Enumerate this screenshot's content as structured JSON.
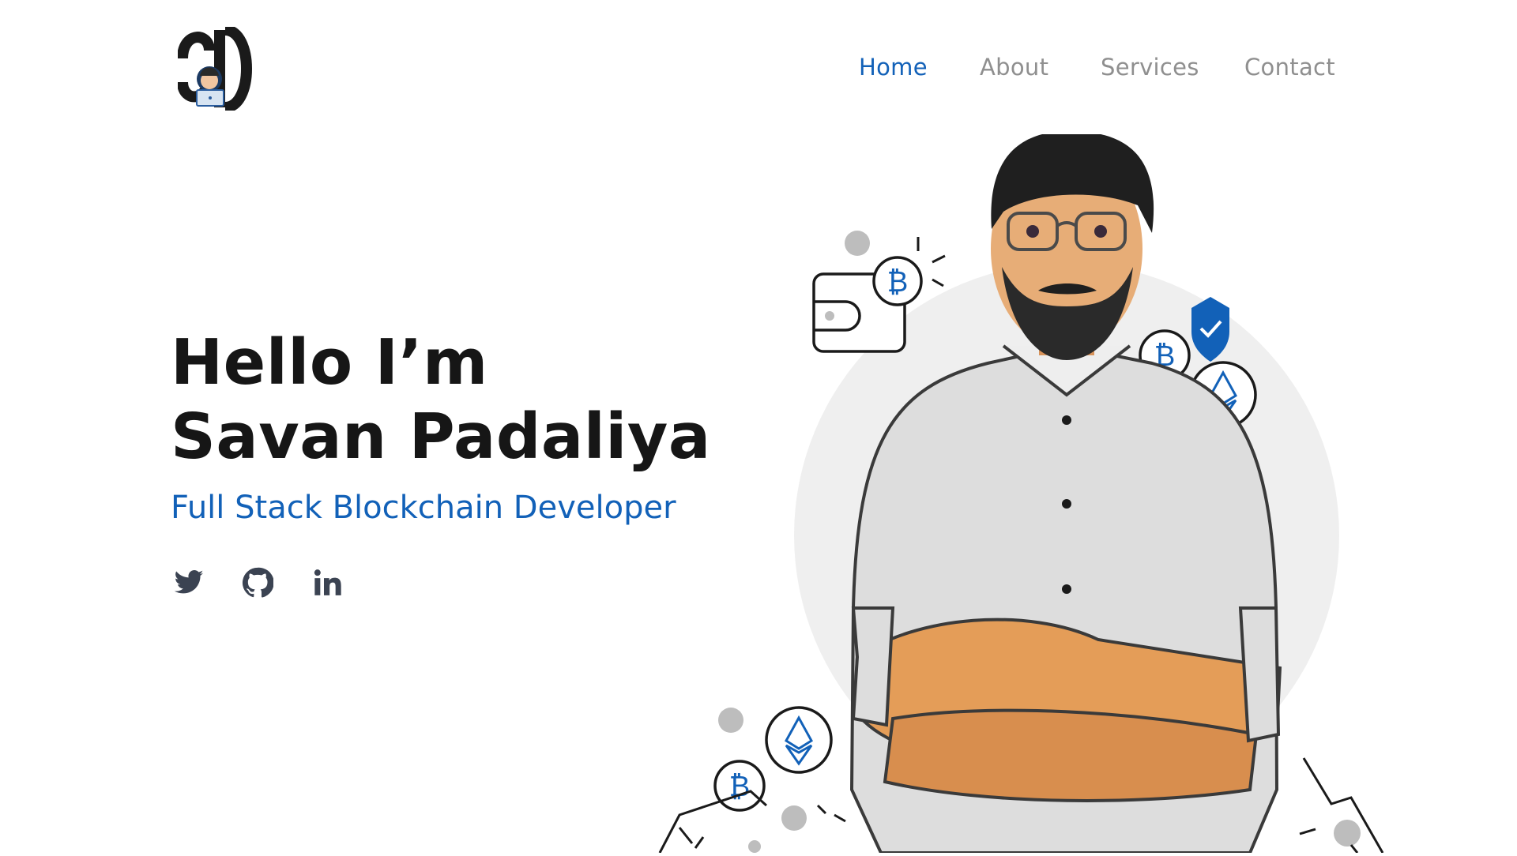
{
  "brand": {
    "logo_icon": "sd-developer-logo"
  },
  "nav": [
    {
      "label": "Home",
      "active": true
    },
    {
      "label": "About",
      "active": false
    },
    {
      "label": "Services",
      "active": false
    },
    {
      "label": "Contact",
      "active": false
    }
  ],
  "hero": {
    "line1": "Hello I’m",
    "line2": "Savan Padaliya",
    "subtitle": "Full Stack Blockchain Developer"
  },
  "socials": [
    {
      "icon": "twitter-icon"
    },
    {
      "icon": "github-icon"
    },
    {
      "icon": "linkedin-icon"
    }
  ],
  "colors": {
    "accent": "#1261b8",
    "text": "#161616",
    "nav_inactive": "#8f8f8f",
    "icon": "#3b4352"
  }
}
